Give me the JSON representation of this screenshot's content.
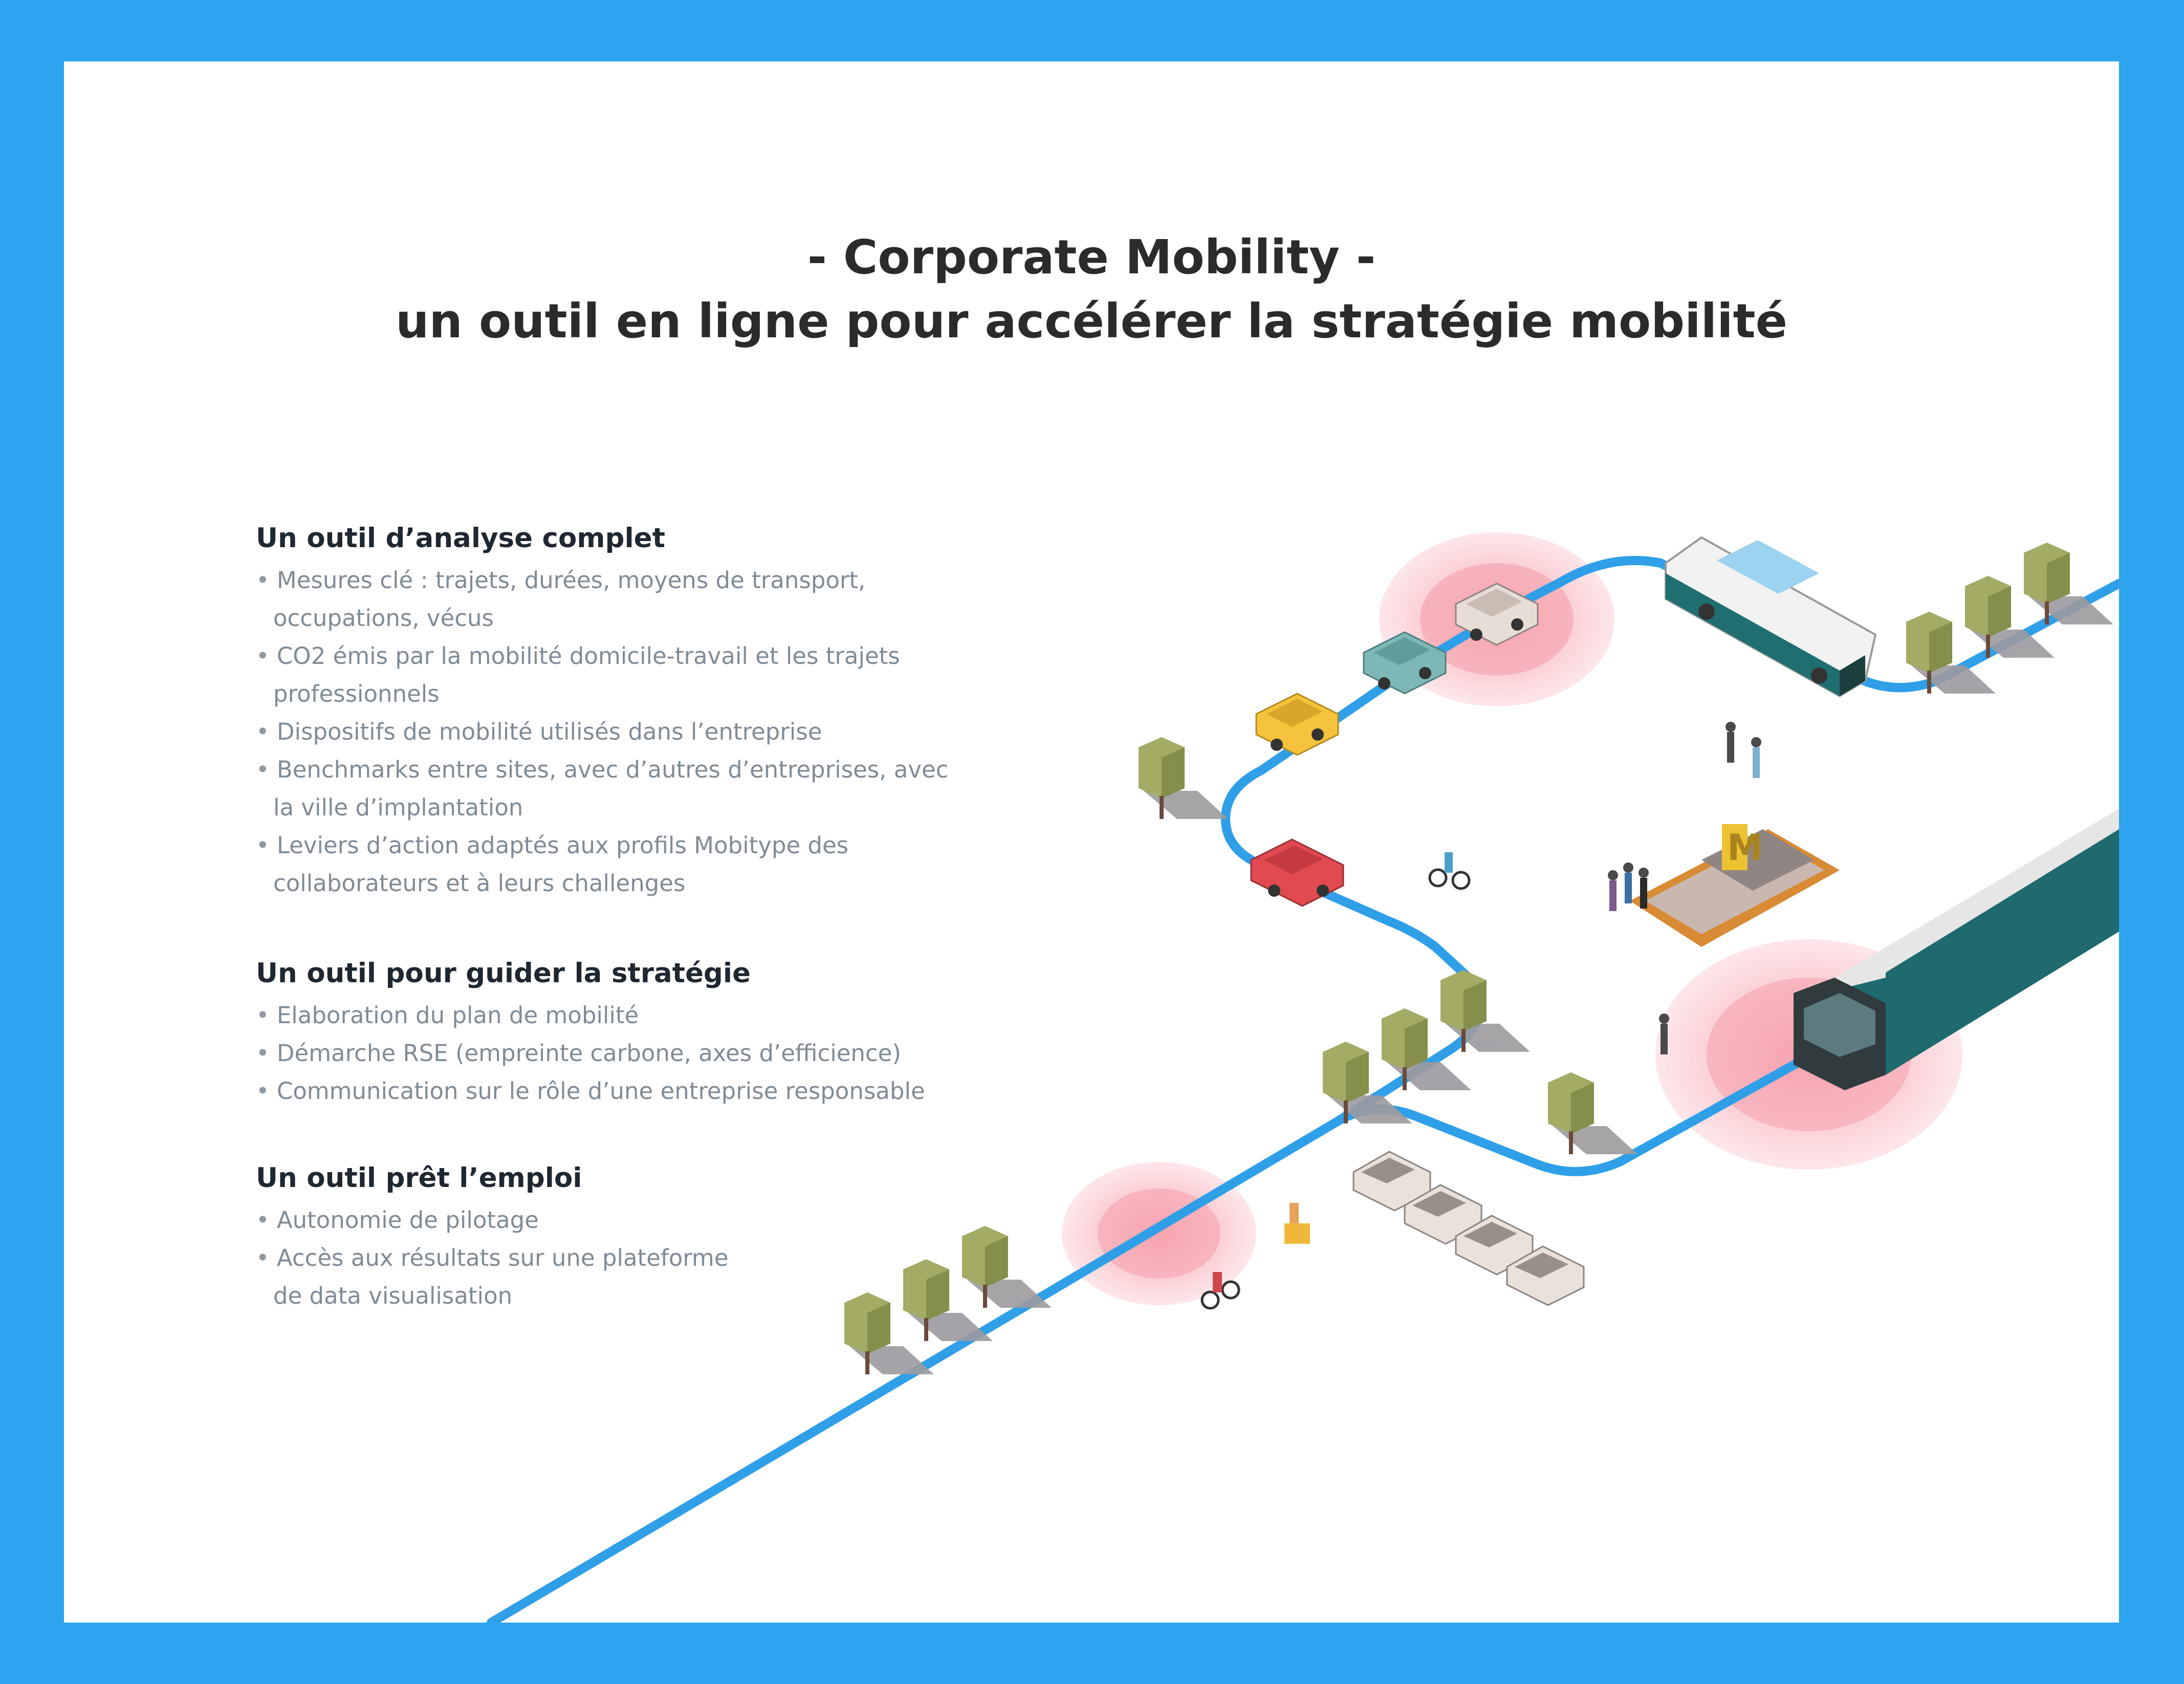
{
  "header": {
    "line1": "- Corporate Mobility -",
    "line2": "un outil en ligne pour accélérer la stratégie mobilité"
  },
  "sections": [
    {
      "title": "Un outil d’analyse complet",
      "items": [
        [
          "Mesures clé : trajets, durées, moyens de transport,",
          "occupations, vécus"
        ],
        [
          "CO2 émis par la mobilité domicile-travail et les trajets",
          "professionnels"
        ],
        [
          "Dispositifs de mobilité utilisés dans l’entreprise",
          ""
        ],
        [
          "Benchmarks entre sites, avec d’autres d’entreprises, avec",
          "la ville d’implantation"
        ],
        [
          "Leviers d’action adaptés aux profils Mobitype des",
          "collaborateurs et à leurs challenges"
        ]
      ]
    },
    {
      "title": "Un outil pour guider la stratégie",
      "items": [
        [
          "Elaboration du plan de mobilité",
          ""
        ],
        [
          "Démarche RSE (empreinte carbone, axes d’efficience)",
          ""
        ],
        [
          "Communication sur le rôle d’une entreprise responsable",
          ""
        ]
      ]
    },
    {
      "title": "Un outil prêt l’emploi",
      "items": [
        [
          "Autonomie de pilotage",
          ""
        ],
        [
          "Accès aux résultats sur une plateforme",
          "de data visualisation"
        ]
      ]
    }
  ],
  "metro_sign": "M",
  "bullet": "•",
  "colors": {
    "frame": "#2ea3ee",
    "route": "#2f9fe8",
    "heading": "#1f2730",
    "body_text": "#7f8b96",
    "hotspot": "#f6a7b0",
    "tree": "#9aa45f"
  }
}
